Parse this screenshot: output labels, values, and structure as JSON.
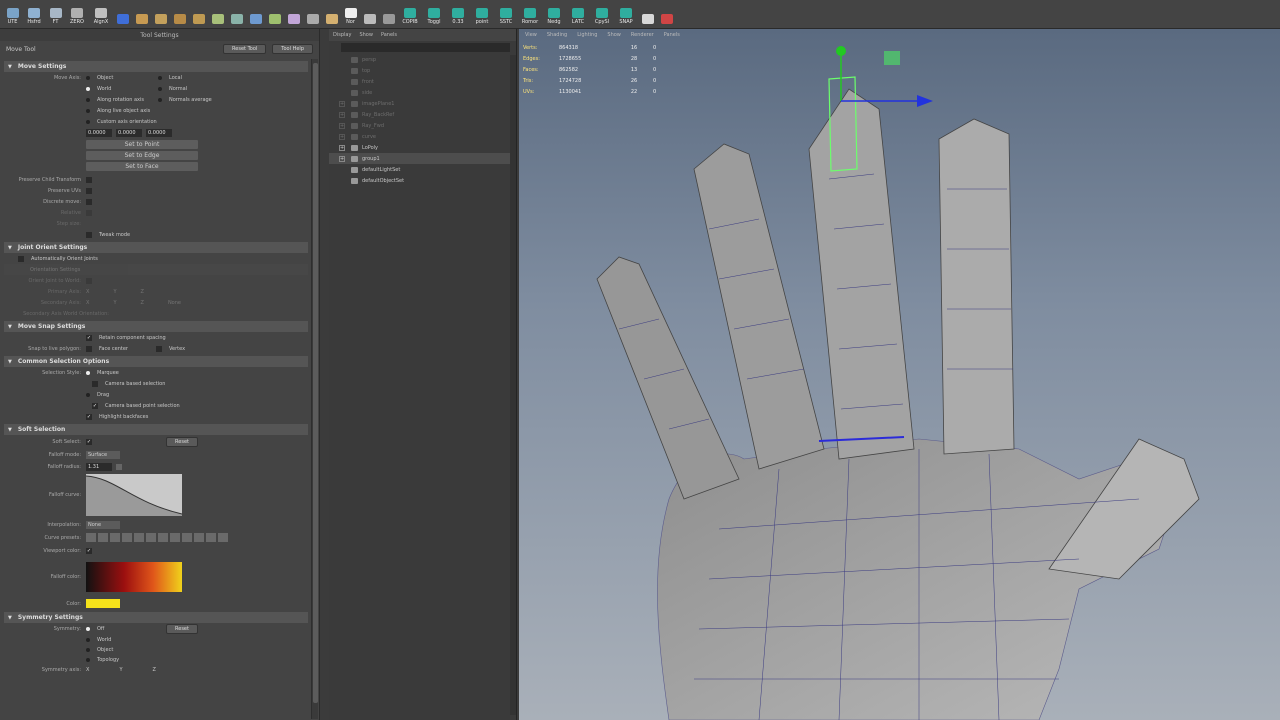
{
  "shelf": {
    "buttons": [
      {
        "label": "UTE",
        "icon": "ute-icon",
        "color": "#7aa3c7"
      },
      {
        "label": "Hsfrd",
        "icon": "hsfrd-icon",
        "color": "#8fb1d1"
      },
      {
        "label": "FT",
        "icon": "ft-icon",
        "color": "#a7b7c7"
      },
      {
        "label": "ZERO",
        "icon": "zero-icon",
        "color": "#b0b0b0"
      },
      {
        "label": "AlgnX",
        "icon": "align-icon",
        "color": "#c0c0c0"
      },
      {
        "label": "",
        "icon": "circle-icon",
        "color": "#3f6ed8"
      },
      {
        "label": "",
        "icon": "cube-icon",
        "color": "#c79a52"
      },
      {
        "label": "",
        "icon": "cube2-icon",
        "color": "#c3a05c"
      },
      {
        "label": "",
        "icon": "hammer-icon",
        "color": "#b78b47"
      },
      {
        "label": "",
        "icon": "bevel-icon",
        "color": "#bf9a52"
      },
      {
        "label": "",
        "icon": "split-icon",
        "color": "#a8c07a"
      },
      {
        "label": "",
        "icon": "cut-icon",
        "color": "#8ab3a9"
      },
      {
        "label": "",
        "icon": "pole-icon",
        "color": "#6e9ad0"
      },
      {
        "label": "",
        "icon": "spin-icon",
        "color": "#9ec06e"
      },
      {
        "label": "",
        "icon": "merge-icon",
        "color": "#c2a6d8"
      },
      {
        "label": "",
        "icon": "loop-icon",
        "color": "#aaa"
      },
      {
        "label": "",
        "icon": "sculpt-icon",
        "color": "#d4b070"
      },
      {
        "label": "Nor",
        "icon": "normal-icon",
        "color": "#eee"
      },
      {
        "label": "",
        "icon": "tool-icon",
        "color": "#bbb"
      },
      {
        "label": "",
        "icon": "snap-icon",
        "color": "#999"
      },
      {
        "label": "COPIB",
        "icon": "copib-icon",
        "color": "#2fae9f"
      },
      {
        "label": "Toggl",
        "icon": "toggle-icon",
        "color": "#2fae9f"
      },
      {
        "label": "0.33",
        "icon": "value-icon",
        "color": "#2fae9f"
      },
      {
        "label": "point",
        "icon": "point-icon",
        "color": "#2fae9f"
      },
      {
        "label": "SSTC",
        "icon": "sstc-icon",
        "color": "#2fae9f"
      },
      {
        "label": "Romor",
        "icon": "romor-icon",
        "color": "#2fae9f"
      },
      {
        "label": "Nedg",
        "icon": "nedg-icon",
        "color": "#2fae9f"
      },
      {
        "label": "LATC",
        "icon": "latc-icon",
        "color": "#2fae9f"
      },
      {
        "label": "CpySl",
        "icon": "copy-select-icon",
        "color": "#2fae9f"
      },
      {
        "label": "SNAP",
        "icon": "snap2-icon",
        "color": "#2fae9f"
      },
      {
        "label": "",
        "icon": "sphere-icon",
        "color": "#d8d8d8"
      },
      {
        "label": "",
        "icon": "paint-icon",
        "color": "#d04545"
      }
    ]
  },
  "tool_settings": {
    "panel_title": "Tool Settings",
    "tool_name": "Move Tool",
    "reset_tool": "Reset Tool",
    "tool_help": "Tool Help",
    "move_settings": {
      "title": "Move Settings",
      "move_axis_label": "Move Axis:",
      "object": "Object",
      "local": "Local",
      "world": "World",
      "normal": "Normal",
      "along_rotation": "Along rotation axis",
      "normals_average": "Normals average",
      "along_live": "Along live object axis",
      "custom_axis": "Custom axis orientation",
      "custom_values": [
        "0.0000",
        "0.0000",
        "0.0000"
      ],
      "set_to_point": "Set to Point",
      "set_to_edge": "Set to Edge",
      "set_to_face": "Set to Face",
      "preserve_child": "Preserve Child Transform",
      "preserve_uvs": "Preserve UVs",
      "discrete_move": "Discrete move:",
      "relative": "Relative",
      "step_size": "Step size:",
      "tweak_mode": "Tweak mode"
    },
    "joint_orient": {
      "title": "Joint Orient Settings",
      "auto_orient": "Automatically Orient Joints",
      "orientation_settings": "Orientation Settings",
      "orient_to_world": "Orient Joint to World:",
      "primary_axis": "Primary Axis:",
      "secondary_axis": "Secondary Axis:",
      "secondary_world": "Secondary Axis World Orientation:",
      "axes": [
        "X",
        "Y",
        "Z"
      ],
      "none": "None"
    },
    "move_snap": {
      "title": "Move Snap Settings",
      "retain": "Retain component spacing",
      "snap_live_label": "Snap to live polygon:",
      "face_center": "Face center",
      "vertex": "Vertex"
    },
    "common_selection": {
      "title": "Common Selection Options",
      "style_label": "Selection Style:",
      "marquee": "Marquee",
      "camera_based": "Camera based selection",
      "drag": "Drag",
      "camera_point": "Camera based point selection",
      "highlight_backface": "Highlight backfaces"
    },
    "soft_selection": {
      "title": "Soft Selection",
      "soft_select_label": "Soft Select:",
      "reset": "Reset",
      "falloff_mode_label": "Falloff mode:",
      "falloff_mode": "Surface",
      "falloff_radius_label": "Falloff radius:",
      "falloff_radius": "1.31",
      "falloff_curve_label": "Falloff curve:",
      "interpolation_label": "Interpolation:",
      "interpolation": "None",
      "curve_presets_label": "Curve presets:",
      "viewport_color_label": "Viewport color:",
      "falloff_color_label": "Falloff color:",
      "color_label": "Color:",
      "color_value": "#f5e21b"
    },
    "symmetry": {
      "title": "Symmetry Settings",
      "symmetry_label": "Symmetry:",
      "off": "Off",
      "world": "World",
      "object": "Object",
      "topology": "Topology",
      "reset": "Reset",
      "symmetry_axis_label": "Symmetry axis:",
      "axes": [
        "X",
        "Y",
        "Z"
      ]
    }
  },
  "outliner": {
    "menu": [
      "Display",
      "Show",
      "Panels"
    ],
    "items": [
      {
        "name": "persp",
        "expandable": false,
        "faded": true,
        "selected": false
      },
      {
        "name": "top",
        "expandable": false,
        "faded": true,
        "selected": false
      },
      {
        "name": "front",
        "expandable": false,
        "faded": true,
        "selected": false
      },
      {
        "name": "side",
        "expandable": false,
        "faded": true,
        "selected": false
      },
      {
        "name": "imagePlane1",
        "expandable": true,
        "faded": true,
        "selected": false
      },
      {
        "name": "Ray_BackRef",
        "expandable": true,
        "faded": true,
        "selected": false
      },
      {
        "name": "Ray_Fwd",
        "expandable": true,
        "faded": true,
        "selected": false
      },
      {
        "name": "curve",
        "expandable": true,
        "faded": true,
        "selected": false
      },
      {
        "name": "LoPoly",
        "expandable": true,
        "faded": false,
        "selected": false
      },
      {
        "name": "group1",
        "expandable": true,
        "faded": false,
        "selected": true
      },
      {
        "name": "defaultLightSet",
        "expandable": false,
        "faded": false,
        "selected": false
      },
      {
        "name": "defaultObjectSet",
        "expandable": false,
        "faded": false,
        "selected": false
      }
    ]
  },
  "viewport": {
    "menu": [
      "View",
      "Shading",
      "Lighting",
      "Show",
      "Renderer",
      "Panels"
    ],
    "hud": [
      {
        "label": "Verts:",
        "a": "864318",
        "b": "16",
        "c": "0"
      },
      {
        "label": "Edges:",
        "a": "1728655",
        "b": "28",
        "c": "0"
      },
      {
        "label": "Faces:",
        "a": "862582",
        "b": "13",
        "c": "0"
      },
      {
        "label": "Tris:",
        "a": "1724728",
        "b": "26",
        "c": "0"
      },
      {
        "label": "UVs:",
        "a": "1130041",
        "b": "22",
        "c": "0"
      }
    ],
    "colors": {
      "selection": "#6cff6c",
      "manip_y": "#22c922",
      "manip_x": "#2233dd",
      "edge": "#2b2bd9"
    }
  }
}
